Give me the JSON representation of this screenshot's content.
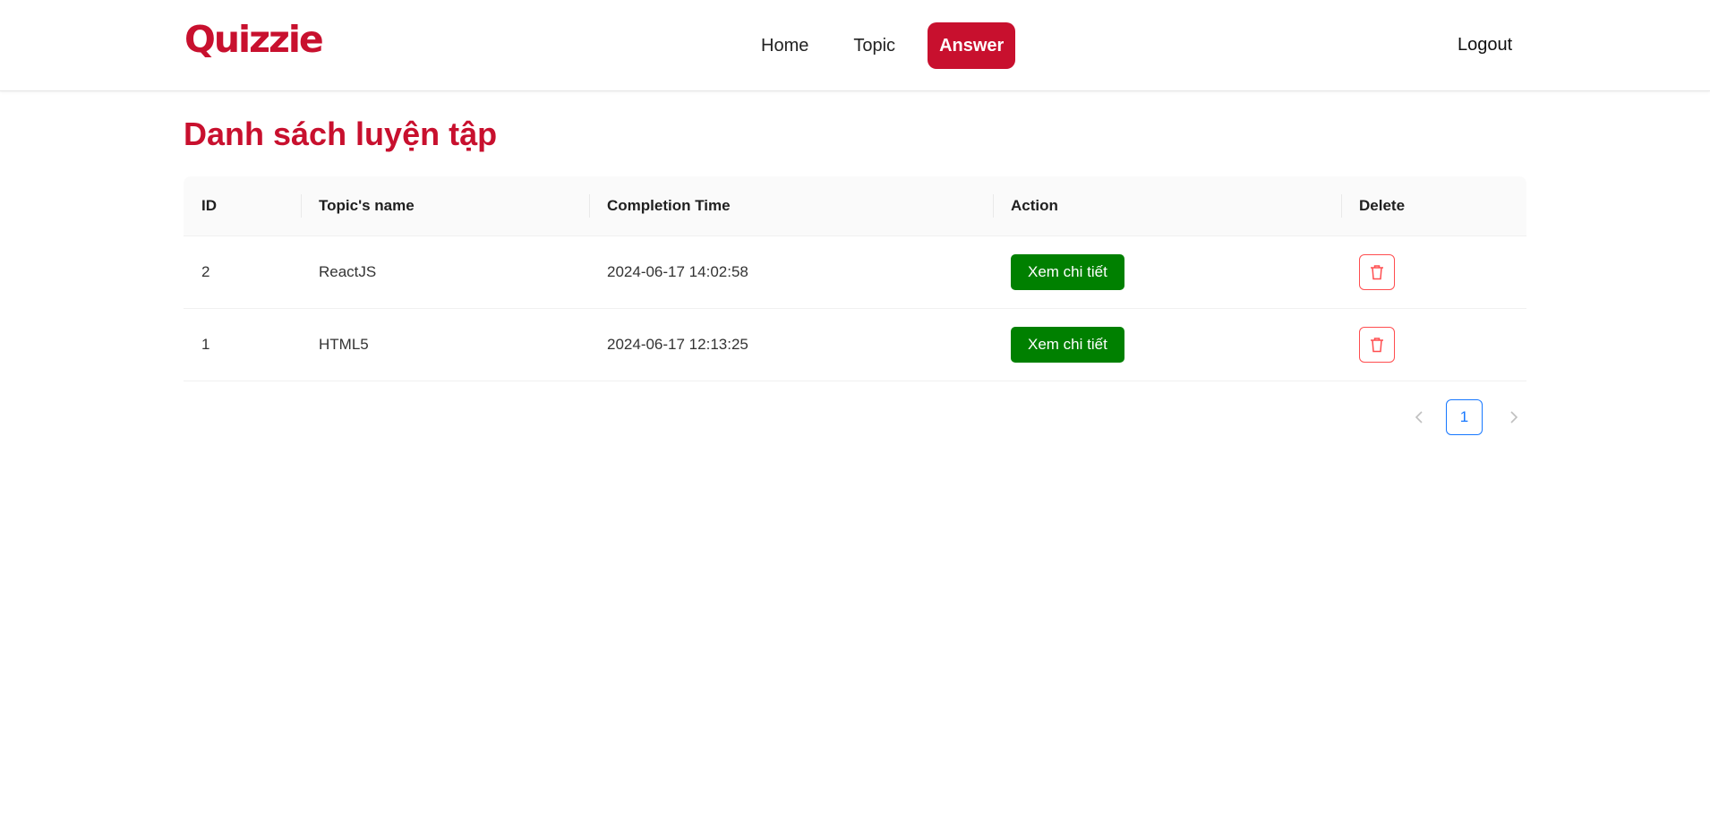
{
  "header": {
    "logo": "Quizzie",
    "nav": [
      {
        "label": "Home",
        "active": false
      },
      {
        "label": "Topic",
        "active": false
      },
      {
        "label": "Answer",
        "active": true
      }
    ],
    "logout": "Logout"
  },
  "main": {
    "title": "Danh sách luyện tập",
    "table": {
      "columns": [
        "ID",
        "Topic's name",
        "Completion Time",
        "Action",
        "Delete"
      ],
      "rows": [
        {
          "id": "2",
          "topic": "ReactJS",
          "time": "2024-06-17 14:02:58",
          "action": "Xem chi tiết"
        },
        {
          "id": "1",
          "topic": "HTML5",
          "time": "2024-06-17 12:13:25",
          "action": "Xem chi tiết"
        }
      ]
    },
    "pagination": {
      "current": "1"
    }
  },
  "colors": {
    "brand": "#c8102e",
    "action_button": "#008000",
    "delete_border": "#ff4d4f",
    "pagination_active": "#1677ff"
  },
  "icons": {
    "delete": "trash-icon",
    "prev": "chevron-left-icon",
    "next": "chevron-right-icon"
  }
}
